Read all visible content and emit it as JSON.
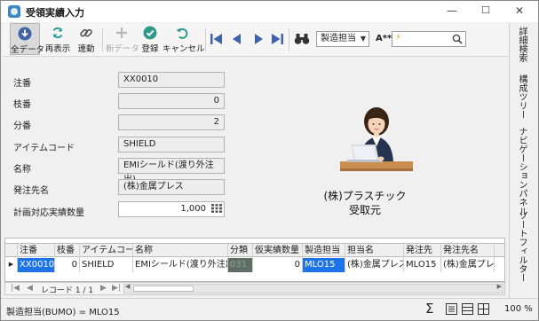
{
  "window": {
    "title": "受領実績入力",
    "minimize": "—",
    "maximize": "☐",
    "close": "✕"
  },
  "toolbar": {
    "all_data": "全データ",
    "redisplay": "再表示",
    "link": "連動",
    "new_data": "新データ",
    "register": "登録",
    "cancel": "キャンセル",
    "combo_value": "製造担当",
    "font_label": "A**",
    "search_value": "⚡"
  },
  "side_tabs": [
    "詳細検索",
    "構成ツリー",
    "ナビゲーションパネル",
    "ソートフィルター"
  ],
  "form": {
    "fields": [
      {
        "label": "注番",
        "value": "XX0010"
      },
      {
        "label": "枝番",
        "value": "0"
      },
      {
        "label": "分番",
        "value": "2"
      },
      {
        "label": "アイテムコード",
        "value": "SHIELD"
      },
      {
        "label": "名称",
        "value": "EMIシールド(渡り外注出)"
      },
      {
        "label": "発注先名",
        "value": "(株)金属プレス"
      },
      {
        "label": "計画対応実績数量",
        "value": "1,000"
      }
    ]
  },
  "company": {
    "name": "(株)プラスチック",
    "role": "受取元"
  },
  "grid": {
    "headers": [
      "注番",
      "枝番",
      "アイテムコード",
      "名称",
      "分類",
      "仮実績数量",
      "製造担当",
      "担当名",
      "発注先",
      "発注先名"
    ],
    "row": [
      "XX0010",
      "0",
      "SHIELD",
      "EMIシールド(渡り外注出)",
      "031",
      "0",
      "MLO15",
      "(株)金属プレス",
      "MLO15",
      "(株)金属プレス"
    ],
    "pager_label": "レコード 1 / 1"
  },
  "status": {
    "text": "製造担当(BUMO) = MLO15",
    "sigma": "Σ",
    "zoom": "100 %"
  },
  "colors": {
    "selection_blue": "#1e73e8",
    "category_gray": "#5f6e62"
  }
}
